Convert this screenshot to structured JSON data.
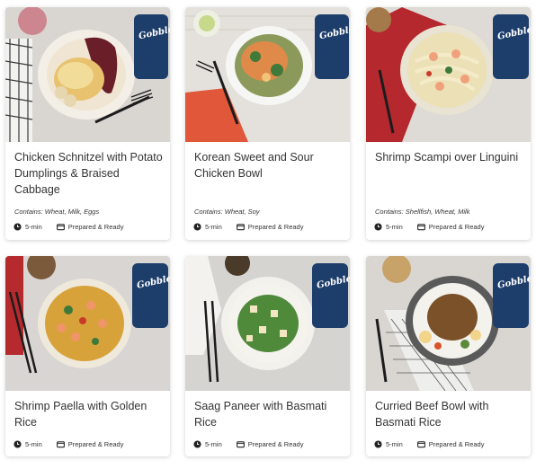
{
  "meals": [
    {
      "name": "Chicken Schnitzel with Potato Dumplings & Braised Cabbage",
      "contains": "Contains: Wheat, Milk, Eggs",
      "time": "5-min",
      "style": "Prepared & Ready",
      "photo": "chicken-schnitzel-photo"
    },
    {
      "name": "Korean Sweet and Sour Chicken Bowl",
      "contains": "Contains: Wheat, Soy",
      "time": "5-min",
      "style": "Prepared & Ready",
      "photo": "korean-chicken-bowl-photo"
    },
    {
      "name": "Shrimp Scampi over Linguini",
      "contains": "Contains: Shellfish, Wheat, Milk",
      "time": "5-min",
      "style": "Prepared & Ready",
      "photo": "shrimp-scampi-photo"
    },
    {
      "name": "Shrimp Paella with Golden Rice",
      "time": "5-min",
      "style": "Prepared & Ready",
      "photo": "shrimp-paella-photo"
    },
    {
      "name": "Saag Paneer with Basmati Rice",
      "time": "5-min",
      "style": "Prepared & Ready",
      "photo": "saag-paneer-photo"
    },
    {
      "name": "Curried Beef Bowl with Basmati Rice",
      "time": "5-min",
      "style": "Prepared & Ready",
      "photo": "curried-beef-photo"
    }
  ],
  "package_brand": "Gobble",
  "icons": {
    "time": "clock-icon",
    "style": "meal-kit-box-icon"
  },
  "colors": {
    "package_navy": "#1d3d6b",
    "text": "#333333"
  }
}
